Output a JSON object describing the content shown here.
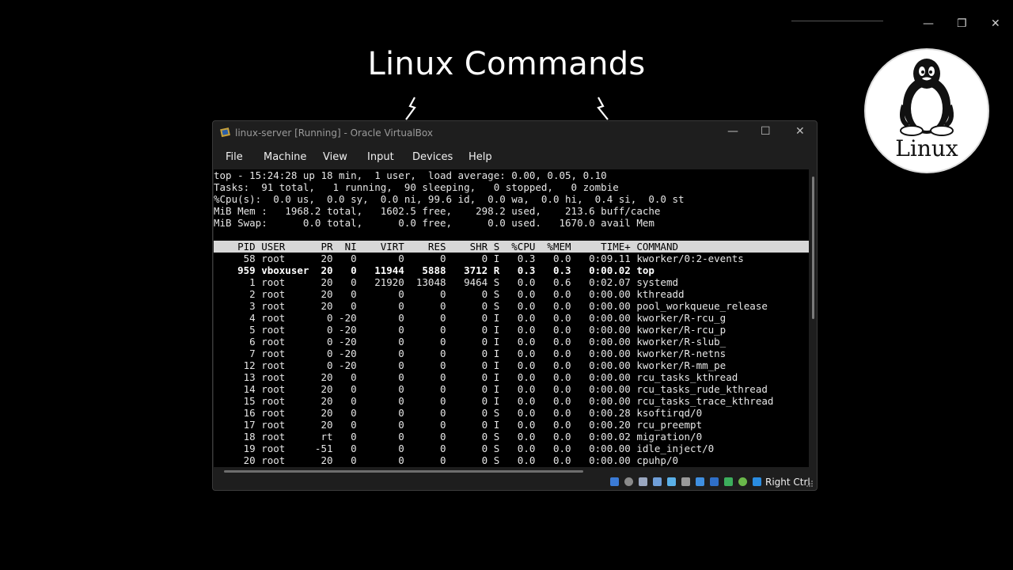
{
  "slide": {
    "title": "Linux Commands"
  },
  "outer_controls": {
    "minimize": "—",
    "restore": "❐",
    "close": "✕"
  },
  "badge": {
    "label": "Linux",
    "icon": "tux-penguin-icon"
  },
  "window": {
    "title": "linux-server [Running] - Oracle VirtualBox",
    "controls": {
      "minimize": "—",
      "maximize": "☐",
      "close": "✕"
    },
    "menu": [
      "File",
      "Machine",
      "View",
      "Input",
      "Devices",
      "Help"
    ],
    "host_key": "Right Ctrl",
    "status_icons": [
      "hard-disk-icon",
      "optical-drive-icon",
      "audio-icon",
      "network-icon",
      "usb-icon",
      "shared-folders-icon",
      "display-icon",
      "video-capture-icon",
      "mouse-integration-icon",
      "keyboard-icon",
      "arrow-down-icon"
    ]
  },
  "terminal": {
    "summary": [
      "top - 15:24:28 up 18 min,  1 user,  load average: 0.00, 0.05, 0.10",
      "Tasks:  91 total,   1 running,  90 sleeping,   0 stopped,   0 zombie",
      "%Cpu(s):  0.0 us,  0.0 sy,  0.0 ni, 99.6 id,  0.0 wa,  0.0 hi,  0.4 si,  0.0 st",
      "MiB Mem :   1968.2 total,   1602.5 free,    298.2 used,    213.6 buff/cache",
      "MiB Swap:      0.0 total,      0.0 free,      0.0 used.   1670.0 avail Mem"
    ],
    "header": "    PID USER      PR  NI    VIRT    RES    SHR S  %CPU  %MEM     TIME+ COMMAND",
    "processes": [
      "     58 root      20   0       0      0      0 I   0.3   0.0   0:09.11 kworker/0:2-events",
      "    959 vboxuser  20   0   11944   5888   3712 R   0.3   0.3   0:00.02 top",
      "      1 root      20   0   21920  13048   9464 S   0.0   0.6   0:02.07 systemd",
      "      2 root      20   0       0      0      0 S   0.0   0.0   0:00.00 kthreadd",
      "      3 root      20   0       0      0      0 S   0.0   0.0   0:00.00 pool_workqueue_release",
      "      4 root       0 -20       0      0      0 I   0.0   0.0   0:00.00 kworker/R-rcu_g",
      "      5 root       0 -20       0      0      0 I   0.0   0.0   0:00.00 kworker/R-rcu_p",
      "      6 root       0 -20       0      0      0 I   0.0   0.0   0:00.00 kworker/R-slub_",
      "      7 root       0 -20       0      0      0 I   0.0   0.0   0:00.00 kworker/R-netns",
      "     12 root       0 -20       0      0      0 I   0.0   0.0   0:00.00 kworker/R-mm_pe",
      "     13 root      20   0       0      0      0 I   0.0   0.0   0:00.00 rcu_tasks_kthread",
      "     14 root      20   0       0      0      0 I   0.0   0.0   0:00.00 rcu_tasks_rude_kthread",
      "     15 root      20   0       0      0      0 I   0.0   0.0   0:00.00 rcu_tasks_trace_kthread",
      "     16 root      20   0       0      0      0 S   0.0   0.0   0:00.28 ksoftirqd/0",
      "     17 root      20   0       0      0      0 I   0.0   0.0   0:00.20 rcu_preempt",
      "     18 root      rt   0       0      0      0 S   0.0   0.0   0:00.02 migration/0",
      "     19 root     -51   0       0      0      0 S   0.0   0.0   0:00.00 idle_inject/0",
      "     20 root      20   0       0      0      0 S   0.0   0.0   0:00.00 cpuhp/0"
    ]
  }
}
